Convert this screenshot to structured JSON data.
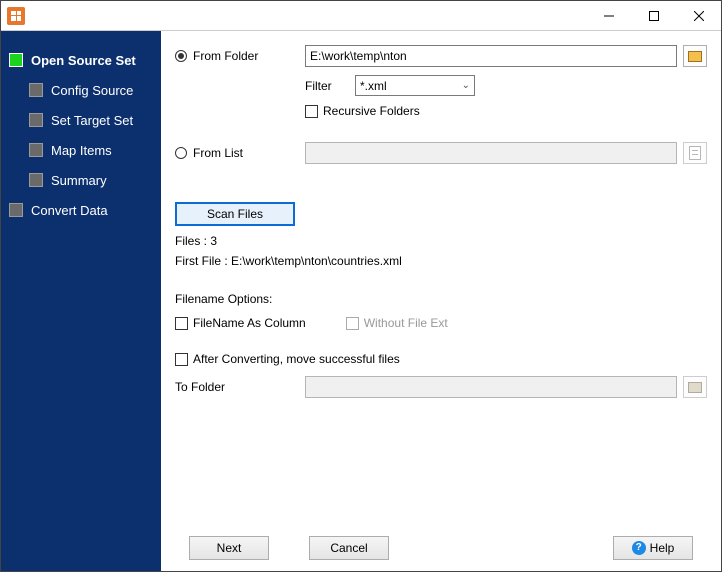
{
  "titlebar": {
    "title": ""
  },
  "sidebar": {
    "items": [
      {
        "label": "Open Source Set",
        "active": true,
        "level": 0
      },
      {
        "label": "Config Source",
        "active": false,
        "level": 1
      },
      {
        "label": "Set Target Set",
        "active": false,
        "level": 1
      },
      {
        "label": "Map Items",
        "active": false,
        "level": 1
      },
      {
        "label": "Summary",
        "active": false,
        "level": 1
      },
      {
        "label": "Convert Data",
        "active": false,
        "level": 0
      }
    ]
  },
  "source": {
    "from_folder_label": "From Folder",
    "from_folder_checked": true,
    "folder_path": "E:\\work\\temp\\nton",
    "filter_label": "Filter",
    "filter_value": "*.xml",
    "recursive_label": "Recursive Folders",
    "recursive_checked": false,
    "from_list_label": "From List",
    "from_list_checked": false,
    "from_list_path": ""
  },
  "scan": {
    "button_label": "Scan Files",
    "files_label": "Files : 3",
    "first_file_label": "First File : E:\\work\\temp\\nton\\countries.xml"
  },
  "filename_opts": {
    "section_label": "Filename Options:",
    "as_column_label": "FileName As Column",
    "as_column_checked": false,
    "without_ext_label": "Without File Ext",
    "without_ext_enabled": false
  },
  "move": {
    "after_label": "After Converting, move successful files",
    "after_checked": false,
    "to_folder_label": "To Folder",
    "to_folder_path": ""
  },
  "footer": {
    "next": "Next",
    "cancel": "Cancel",
    "help": "Help"
  }
}
